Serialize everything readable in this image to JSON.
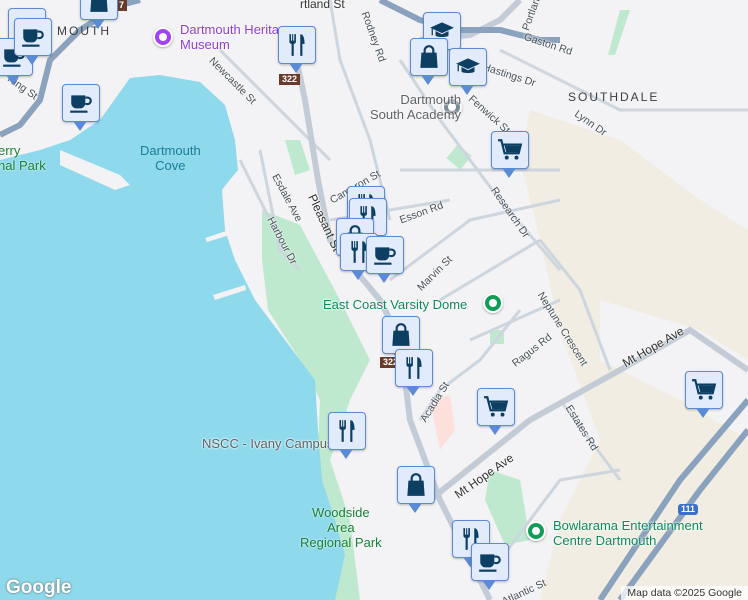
{
  "map": {
    "colors": {
      "water": "#8fd9ec",
      "land": "#f3f2f4",
      "park": "#bfe9cf",
      "tan": "#f1ede2",
      "road": "#cdd5de",
      "highway": "#8aa2bd",
      "pin_bg": "#e2ebfb",
      "pin_border": "#5b8ad6",
      "icon": "#0d3f62"
    },
    "areas": [
      "SOUTHDALE",
      "MOUTH"
    ],
    "water_labels": [
      "Dartmouth\nCove"
    ],
    "park_labels": [
      "Woodside\nArea\nRegional Park",
      "erry\nnal Park"
    ],
    "pois": [
      {
        "name": "Dartmouth Heritage Museum",
        "icon": "museum-icon",
        "color": "#a142f4"
      },
      {
        "name": "Dartmouth\nSouth Academy",
        "icon": "school-icon",
        "color": "#7d8a96"
      },
      {
        "name": "East Coast Varsity Dome",
        "icon": "pin-icon",
        "color": "#0f9d58"
      },
      {
        "name": "NSCC - Ivany Campus",
        "icon": "",
        "color": ""
      },
      {
        "name": "Bowlarama Entertainment\nCentre Dartmouth",
        "icon": "pin-icon",
        "color": "#0f9d58"
      }
    ],
    "streets": [
      "King St",
      "Newcastle St",
      "Rodney Rd",
      "Gaston Rd",
      "Hastings Dr",
      "Fenwick St",
      "Lynn Dr",
      "Cameron St",
      "Esdale Ave",
      "Harbour Dr",
      "Pleasant St",
      "Esson Rd",
      "Research Dr",
      "Marvin St",
      "Neptune Crescent",
      "Ragus Rd",
      "Mt Hope Ave",
      "Acadia St",
      "Estates Rd",
      "Mt Hope Ave",
      "Atlantic St",
      "Portland St",
      "rtland St",
      "th"
    ],
    "shields": [
      {
        "label": "322",
        "color": "#6b3a2a"
      },
      {
        "label": "322",
        "color": "#6b3a2a"
      },
      {
        "label": "111",
        "color": "#3b6fc9"
      },
      {
        "label": "7",
        "color": "#6b3a2a"
      }
    ],
    "markers": [
      "coffee-cup-icon",
      "coffee-cup-icon",
      "coffee-cup-icon",
      "coffee-cup-icon",
      "shopping-bag-icon",
      "fork-knife-icon",
      "graduation-cap-icon",
      "shopping-bag-icon",
      "graduation-cap-icon",
      "shopping-cart-icon",
      "fork-knife-icon",
      "fork-knife-icon",
      "shopping-bag-icon",
      "fork-knife-icon",
      "coffee-cup-icon",
      "shopping-bag-icon",
      "fork-knife-icon",
      "shopping-cart-icon",
      "shopping-cart-icon",
      "fork-knife-icon",
      "shopping-bag-icon",
      "fork-knife-icon",
      "coffee-cup-icon"
    ],
    "logo": "Google",
    "attribution": "Map data ©2025 Google"
  }
}
